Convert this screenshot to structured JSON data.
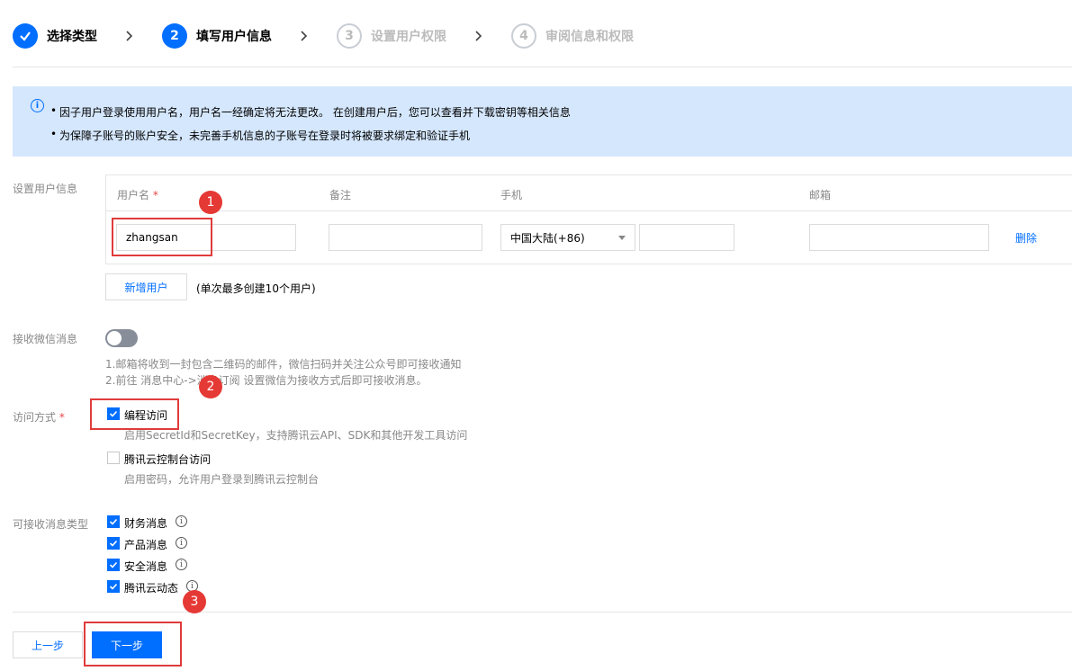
{
  "steps": [
    {
      "number": "",
      "label": "选择类型",
      "state": "done"
    },
    {
      "number": "2",
      "label": "填写用户信息",
      "state": "active"
    },
    {
      "number": "3",
      "label": "设置用户权限",
      "state": "todo"
    },
    {
      "number": "4",
      "label": "审阅信息和权限",
      "state": "todo"
    }
  ],
  "info": {
    "lines": [
      "因子用户登录使用用户名，用户名一经确定将无法更改。 在创建用户后，您可以查看并下载密钥等相关信息",
      "为保障子账号的账户安全，未完善手机信息的子账号在登录时将被要求绑定和验证手机"
    ]
  },
  "user_info": {
    "section_label": "设置用户信息",
    "columns": {
      "username": "用户名",
      "username_required": "*",
      "remark": "备注",
      "phone": "手机",
      "email": "邮箱"
    },
    "row": {
      "username": "zhangsan",
      "remark": "",
      "phone_region": "中国大陆(+86)",
      "phone": "",
      "email": "",
      "delete_label": "删除"
    },
    "add_button": "新增用户",
    "add_hint": "(单次最多创建10个用户)"
  },
  "wechat": {
    "label": "接收微信消息",
    "enabled": false,
    "note1": "1.邮箱将收到一封包含二维码的邮件，微信扫码并关注公众号即可接收通知",
    "note2": "2.前往 消息中心->消息订阅 设置微信为接收方式后即可接收消息。"
  },
  "access": {
    "label": "访问方式",
    "required": "*",
    "options": [
      {
        "label": "编程访问",
        "checked": true,
        "desc": "启用SecretId和SecretKey，支持腾讯云API、SDK和其他开发工具访问"
      },
      {
        "label": "腾讯云控制台访问",
        "checked": false,
        "desc": "启用密码，允许用户登录到腾讯云控制台"
      }
    ]
  },
  "messages": {
    "label": "可接收消息类型",
    "options": [
      {
        "label": "财务消息",
        "checked": true
      },
      {
        "label": "产品消息",
        "checked": true
      },
      {
        "label": "安全消息",
        "checked": true
      },
      {
        "label": "腾讯云动态",
        "checked": true
      }
    ]
  },
  "footer": {
    "prev": "上一步",
    "next": "下一步"
  },
  "annotations": [
    "1",
    "2",
    "3"
  ],
  "colors": {
    "primary": "#006eff",
    "info_bg": "#d5e7fd",
    "annotation": "#e53935"
  }
}
